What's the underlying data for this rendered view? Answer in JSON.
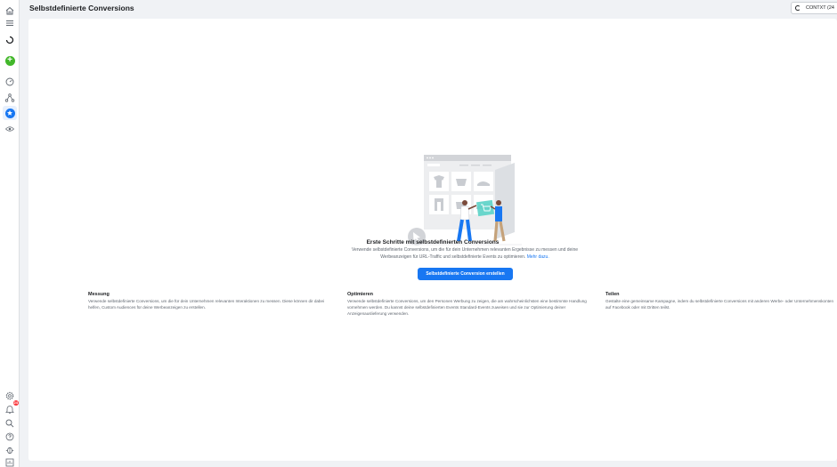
{
  "header": {
    "title": "Selbstdefinierte Conversions",
    "context_label": "CONTXT (24"
  },
  "sidebar": {
    "items": [
      {
        "icon": "home-icon"
      },
      {
        "icon": "menu-icon"
      },
      {
        "icon": "loading-icon"
      },
      {
        "icon": "create-plus-icon"
      },
      {
        "icon": "dashboard-gauge-icon"
      },
      {
        "icon": "network-icon"
      },
      {
        "icon": "star-icon",
        "active": true
      },
      {
        "icon": "eye-icon"
      }
    ],
    "bottom_items": [
      {
        "icon": "settings-gear-icon"
      },
      {
        "icon": "notifications-bell-icon",
        "badge": "24"
      },
      {
        "icon": "search-icon"
      },
      {
        "icon": "help-icon"
      },
      {
        "icon": "bug-icon"
      },
      {
        "icon": "reports-icon"
      }
    ]
  },
  "empty_state": {
    "title": "Erste Schritte mit selbstdefinierten Conversions",
    "description": "Verwende selbstdefinierte Conversions, um die für dein Unternehmen relevanten Ergebnisse zu messen und deine Werbeanzeigen für URL-Traffic und selbstdefinierte Events zu optimieren.",
    "link_label": "Mehr dazu.",
    "button_label": "Selbstdefinierte Conversion erstellen"
  },
  "features": [
    {
      "title": "Messung",
      "text": "Verwende selbstdefinierte Conversions, um die für dein Unternehmen relevanten Interaktionen zu messen. Diese können dir dabei helfen, Custom Audiences für deine Werbeanzeigen zu erstellen."
    },
    {
      "title": "Optimieren",
      "text": "Verwende selbstdefinierte Conversions, um den Personen Werbung zu zeigen, die am wahrscheinlichsten eine bestimmte Handlung vornehmen werden. Du kannst deine selbstdefinierten Events Standard-Events zuweisen und sie zur Optimierung deiner Anzeigenauslieferung verwenden."
    },
    {
      "title": "Teilen",
      "text": "Gestalte eine gemeinsame Kampagne, indem du selbstdefinierte Conversions mit anderen Werbe- oder Unternehmenskonten auf Facebook oder mit Dritten teilst."
    }
  ],
  "colors": {
    "accent": "#1877f2",
    "create": "#42b72a",
    "badge": "#fa383e",
    "background": "#f0f2f5"
  }
}
